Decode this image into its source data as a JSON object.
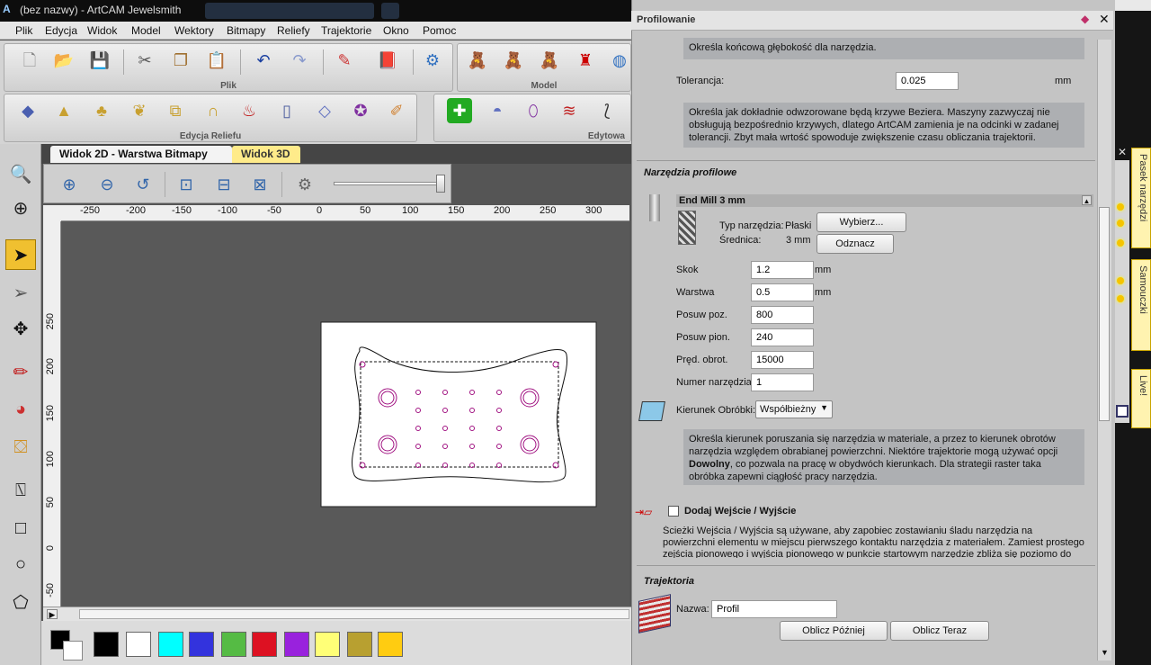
{
  "titlebar": {
    "title": "(bez nazwy) - ArtCAM Jewelsmith"
  },
  "menu": [
    "Plik",
    "Edycja",
    "Widok",
    "Model",
    "Wektory",
    "Bitmapy",
    "Reliefy",
    "Trajektorie",
    "Okno",
    "Pomoc"
  ],
  "toolbars": {
    "file_title": "Plik",
    "model_title": "Model",
    "relief_title": "Edycja Reliefu",
    "vector_title": "Edytowa"
  },
  "view_tabs": {
    "tab2d": "Widok 2D - Warstwa Bitmapy",
    "tab3d": "Widok 3D"
  },
  "ruler": {
    "h_labels": [
      "-250",
      "-200",
      "-150",
      "-100",
      "-50",
      "0",
      "50",
      "100",
      "150",
      "200",
      "250",
      "300"
    ],
    "v_labels": [
      "250",
      "200",
      "150",
      "100",
      "50",
      "0",
      "-50"
    ]
  },
  "palette": {
    "colors": [
      "#000000",
      "#ffffff",
      "#00ffff",
      "#3333dd",
      "#55bb44",
      "#dd1122",
      "#9922dd",
      "#ffff77",
      "#b8a030",
      "#ffcc11"
    ]
  },
  "panel": {
    "title": "Profilowanie",
    "depth_info": "Określa końcową głębokość dla narzędzia.",
    "tolerance_label": "Tolerancja:",
    "tolerance_value": "0.025",
    "tolerance_unit": "mm",
    "tolerance_info": "Określa jak dokładnie odwzorowane będą krzywe Beziera. Maszyny zazwyczaj nie obsługują bezpośrednio krzywych, dlatego ArtCAM zamienia je na odcinki w zadanej tolerancji. Zbyt mała wrtość spowoduje zwiększenie czasu obliczania trajektorii.",
    "tools_section": "Narzędzia profilowe",
    "tool_name": "End Mill 3 mm",
    "tool_type_label": "Typ narzędzia:",
    "tool_type_value": "Płaski",
    "diameter_label": "Średnica:",
    "diameter_value": "3 mm",
    "select_button": "Wybierz...",
    "deselect_button": "Odznacz",
    "fields": [
      {
        "label": "Skok",
        "value": "1.2",
        "unit": "mm"
      },
      {
        "label": "Warstwa",
        "value": "0.5",
        "unit": "mm"
      },
      {
        "label": "Posuw poz.",
        "value": "800",
        "unit": ""
      },
      {
        "label": "Posuw pion.",
        "value": "240",
        "unit": ""
      },
      {
        "label": "Pręd. obrot.",
        "value": "15000",
        "unit": ""
      },
      {
        "label": "Numer narzędzia",
        "value": "1",
        "unit": ""
      }
    ],
    "direction_label": "Kierunek Obróbki:",
    "direction_value": "Współbieżny",
    "direction_info_1": "Określa kierunek poruszania się narzędzia w materiale, a przez to kierunek obrotów narzędzia względem obrabianej powierzchni. Niektóre trajektorie mogą używać opcji ",
    "direction_info_bold": "Dowolny",
    "direction_info_2": ", co pozwala na pracę w obydwóch kierunkach. Dla strategii raster taka obróbka zapewni ciągłość pracy narzędzia.",
    "leadin_label": "Dodaj Wejście / Wyjście",
    "leadin_info": "Ścieżki Wejścia / Wyjścia są używane, aby zapobiec zostawianiu śladu narzędzia na powierzchni elementu w miejscu pierwszego kontaktu narzędzia z materiałem. Zamiest prostego zejścia pionowego i wyjścia pionowego w punkcie startowym narzędzie zbliża się poziomo do profilu z",
    "toolpath_section": "Trajektoria",
    "name_label": "Nazwa:",
    "name_value": "Profil",
    "calc_later": "Oblicz Później",
    "calc_now": "Oblicz Teraz"
  },
  "side_tabs": [
    "Pasek narzędzi",
    "Samouczki",
    "Live!"
  ]
}
